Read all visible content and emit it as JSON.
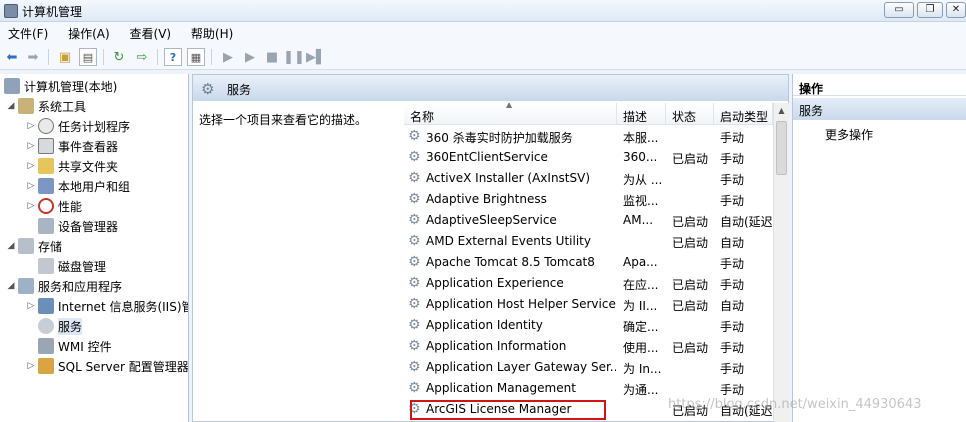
{
  "window": {
    "title": "计算机管理",
    "minimize_icon": "▭",
    "restore_icon": "❐",
    "close_icon": "✕"
  },
  "menu": [
    "文件(F)",
    "操作(A)",
    "查看(V)",
    "帮助(H)"
  ],
  "toolbar_icons": [
    "back-arrow-icon",
    "forward-arrow-icon",
    "folder-up-icon",
    "show-tree-icon",
    "refresh-icon",
    "export-list-icon",
    "help-icon",
    "properties-icon",
    "play-icon",
    "play-alt-icon",
    "stop-icon",
    "pause-icon",
    "restart-icon"
  ],
  "tree": {
    "root": "计算机管理(本地)",
    "nodes": [
      {
        "label": "系统工具"
      },
      {
        "label": "任务计划程序"
      },
      {
        "label": "事件查看器"
      },
      {
        "label": "共享文件夹"
      },
      {
        "label": "本地用户和组"
      },
      {
        "label": "性能"
      },
      {
        "label": "设备管理器"
      },
      {
        "label": "存储"
      },
      {
        "label": "磁盘管理"
      },
      {
        "label": "服务和应用程序"
      },
      {
        "label": "Internet 信息服务(IIS)管"
      },
      {
        "label": "服务"
      },
      {
        "label": "WMI 控件"
      },
      {
        "label": "SQL Server 配置管理器"
      }
    ]
  },
  "center": {
    "title": "服务",
    "description": "选择一个项目来查看它的描述。",
    "columns": {
      "name": "名称",
      "desc": "描述",
      "status": "状态",
      "startup": "启动类型"
    },
    "rows": [
      {
        "name": "360 杀毒实时防护加载服务",
        "desc": "本服...",
        "status": "",
        "startup": "手动"
      },
      {
        "name": "360EntClientService",
        "desc": "360...",
        "status": "已启动",
        "startup": "手动"
      },
      {
        "name": "ActiveX Installer (AxInstSV)",
        "desc": "为从 ...",
        "status": "",
        "startup": "手动"
      },
      {
        "name": "Adaptive Brightness",
        "desc": "监视...",
        "status": "",
        "startup": "手动"
      },
      {
        "name": "AdaptiveSleepService",
        "desc": "AM...",
        "status": "已启动",
        "startup": "自动(延迟"
      },
      {
        "name": "AMD External Events Utility",
        "desc": "",
        "status": "已启动",
        "startup": "自动"
      },
      {
        "name": "Apache Tomcat 8.5 Tomcat8",
        "desc": "Apa...",
        "status": "",
        "startup": "手动"
      },
      {
        "name": "Application Experience",
        "desc": "在应...",
        "status": "已启动",
        "startup": "手动"
      },
      {
        "name": "Application Host Helper Service",
        "desc": "为 II...",
        "status": "已启动",
        "startup": "自动"
      },
      {
        "name": "Application Identity",
        "desc": "确定...",
        "status": "",
        "startup": "手动"
      },
      {
        "name": "Application Information",
        "desc": "使用...",
        "status": "已启动",
        "startup": "手动"
      },
      {
        "name": "Application Layer Gateway Ser...",
        "desc": "为 In...",
        "status": "",
        "startup": "手动"
      },
      {
        "name": "Application Management",
        "desc": "为通...",
        "status": "",
        "startup": "手动"
      },
      {
        "name": "ArcGIS License Manager",
        "desc": "",
        "status": "已启动",
        "startup": "自动(延迟"
      }
    ]
  },
  "actions": {
    "header": "操作",
    "section": "服务",
    "item": "更多操作"
  },
  "watermark": "https://blog.csdn.net/weixin_44930643"
}
